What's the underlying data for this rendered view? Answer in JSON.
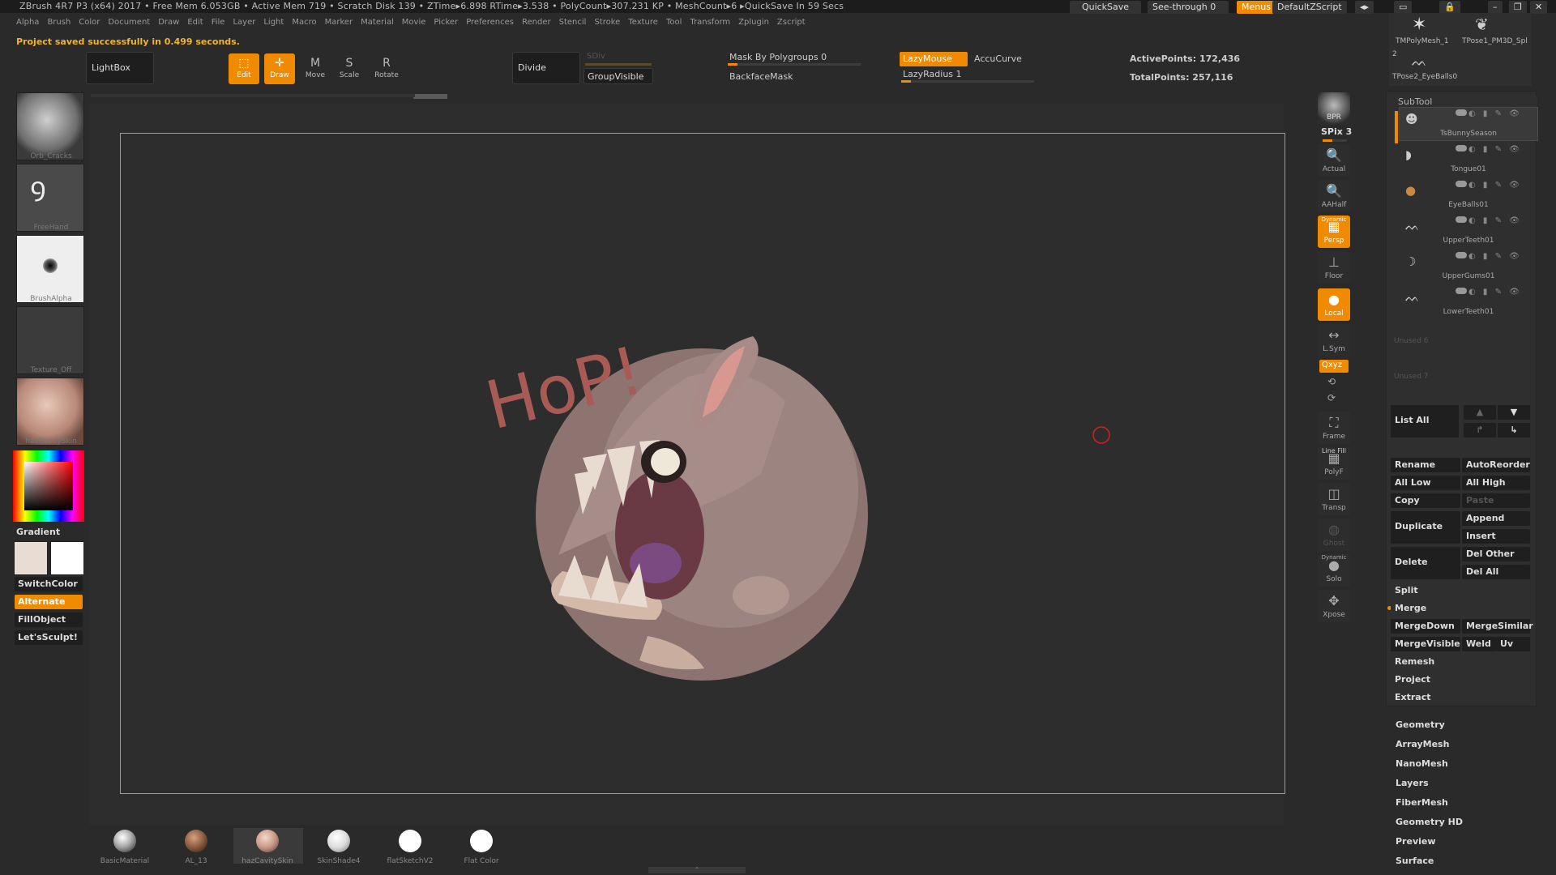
{
  "titlebar": {
    "info": "ZBrush 4R7 P3 (x64)   2017     • Free Mem 6.053GB • Active Mem 719 • Scratch Disk 139 •  ZTime▸6.898 RTime▸3.538 • PolyCount▸307.231 KP  • MeshCount▸6   ▸QuickSave In 59 Secs",
    "quicksave": "QuickSave",
    "seethrough": "See-through  0",
    "menus": "Menus",
    "zscript": "DefaultZScript"
  },
  "menubar": [
    "Alpha",
    "Brush",
    "Color",
    "Document",
    "Draw",
    "Edit",
    "File",
    "Layer",
    "Light",
    "Macro",
    "Marker",
    "Material",
    "Movie",
    "Picker",
    "Preferences",
    "Render",
    "Stencil",
    "Stroke",
    "Texture",
    "Tool",
    "Transform",
    "Zplugin",
    "Zscript"
  ],
  "status": "Project saved successfully in 0.499 seconds.",
  "toolbar": {
    "lightbox": "LightBox",
    "edit": "Edit",
    "draw": "Draw",
    "move": "Move",
    "scale": "Scale",
    "rotate": "Rotate",
    "divide": "Divide",
    "sdiv": "SDiv",
    "groupvisible": "GroupVisible",
    "mask_by_polygroups": "Mask By Polygroups 0",
    "backfacemask": "BackfaceMask",
    "lazymouse": "LazyMouse",
    "accucurve": "AccuCurve",
    "lazyradius": "LazyRadius 1",
    "activepoints": "ActivePoints: 172,436",
    "totalpoints": "TotalPoints: 257,116"
  },
  "leftshelf": {
    "brush1": "Orb_Cracks",
    "brush2": "FreeHand",
    "alpha": "BrushAlpha",
    "texture": "Texture_Off",
    "material": "hazCavitySkin",
    "gradient": "Gradient",
    "switchcolor": "SwitchColor",
    "alternate": "Alternate",
    "fillobject": "FillObject",
    "letssculpt": "Let'sSculpt!"
  },
  "rightshelf": {
    "bpr": "BPR",
    "spix": "SPix 3",
    "actual": "Actual",
    "aahalf": "AAHalf",
    "dynamic": "Dynamic",
    "persp": "Persp",
    "floor": "Floor",
    "local": "Local",
    "lsym": "L.Sym",
    "xyz": "Qxyz",
    "frame": "Frame",
    "linefill": "Line Fill",
    "polyf": "PolyF",
    "transp": "Transp",
    "ghost": "Ghost",
    "solo": "Solo",
    "dynamic2": "Dynamic",
    "xpose": "Xpose"
  },
  "topright_tools": {
    "t1": "TMPolyMesh_1",
    "t2": "TPose1_PM3D_Spl",
    "t3": "2",
    "t4": "TPose2_EyeBalls0"
  },
  "subtool": {
    "title": "SubTool",
    "items": [
      {
        "name": "TsBunnySeason"
      },
      {
        "name": "Tongue01"
      },
      {
        "name": "EyeBalls01"
      },
      {
        "name": "UpperTeeth01"
      },
      {
        "name": "UpperGums01"
      },
      {
        "name": "LowerTeeth01"
      }
    ],
    "unused1": "Unused 6",
    "unused2": "Unused 7",
    "listall": "List  All",
    "rename": "Rename",
    "autoreorder": "AutoReorder",
    "alllow": "All Low",
    "allhigh": "All High",
    "copy": "Copy",
    "paste": "Paste",
    "append": "Append",
    "duplicate": "Duplicate",
    "insert": "Insert",
    "delother": "Del Other",
    "delete": "Delete",
    "delall": "Del All",
    "split": "Split",
    "merge": "Merge",
    "mergedown": "MergeDown",
    "mergesimilar": "MergeSimilar",
    "mergevisible": "MergeVisible",
    "weld": "Weld",
    "uv": "Uv",
    "remesh": "Remesh",
    "project": "Project",
    "extract": "Extract"
  },
  "sections": [
    "Geometry",
    "ArrayMesh",
    "NanoMesh",
    "Layers",
    "FiberMesh",
    "Geometry HD",
    "Preview",
    "Surface"
  ],
  "materials": [
    "BasicMaterial",
    "AL_13",
    "hazCavitySkin",
    "SkinShade4",
    "flatSketchV2",
    "Flat Color"
  ],
  "canvas_text": "HoP!"
}
